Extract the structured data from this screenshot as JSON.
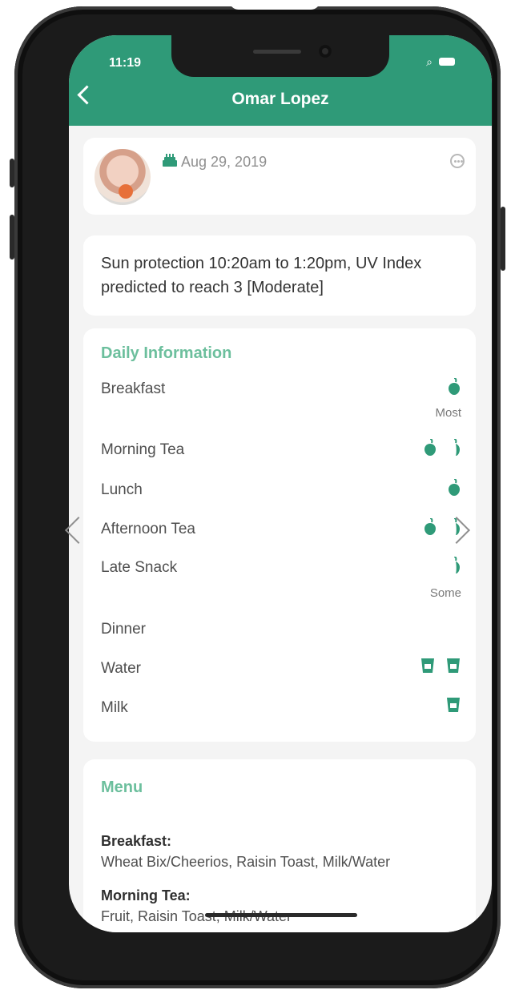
{
  "status_bar": {
    "time": "11:19"
  },
  "header": {
    "title": "Omar Lopez"
  },
  "profile": {
    "date": "Aug 29, 2019"
  },
  "notice": {
    "text": "Sun protection 10:20am to 1:20pm, UV Index predicted to reach 3 [Moderate]"
  },
  "daily": {
    "title": "Daily Information",
    "rows": [
      {
        "label": "Breakfast",
        "note": "Most"
      },
      {
        "label": "Morning Tea"
      },
      {
        "label": "Lunch"
      },
      {
        "label": "Afternoon Tea"
      },
      {
        "label": "Late Snack",
        "note": "Some"
      },
      {
        "label": "Dinner"
      },
      {
        "label": "Water"
      },
      {
        "label": "Milk"
      }
    ]
  },
  "menu": {
    "title": "Menu",
    "items": [
      {
        "label": "Breakfast:",
        "text": "Wheat Bix/Cheerios, Raisin Toast, Milk/Water"
      },
      {
        "label": "Morning Tea:",
        "text": "Fruit, Raisin Toast, Milk/Water"
      }
    ]
  },
  "colors": {
    "accent": "#2f9a78",
    "section_title": "#6cbf9d"
  },
  "icons": [
    "back-icon",
    "wifi-icon",
    "battery-icon",
    "birthday-icon",
    "more-icon",
    "apple-icon",
    "cup-icon",
    "chevron-left-icon",
    "chevron-right-icon"
  ]
}
